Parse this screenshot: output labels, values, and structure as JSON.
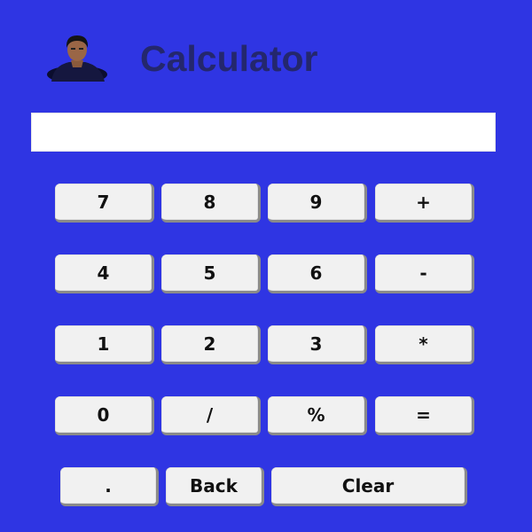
{
  "header": {
    "title": "Calculator"
  },
  "display": {
    "value": ""
  },
  "keypad": {
    "row1": [
      "7",
      "8",
      "9",
      "+"
    ],
    "row2": [
      "4",
      "5",
      "6",
      "-"
    ],
    "row3": [
      "1",
      "2",
      "3",
      "*"
    ],
    "row4": [
      "0",
      "/",
      "%",
      "="
    ],
    "row5": [
      ".",
      "Back",
      "Clear"
    ]
  },
  "colors": {
    "background": "#2f35e3",
    "title": "#24276d",
    "button": "#f1f1f1",
    "display": "#ffffff"
  }
}
